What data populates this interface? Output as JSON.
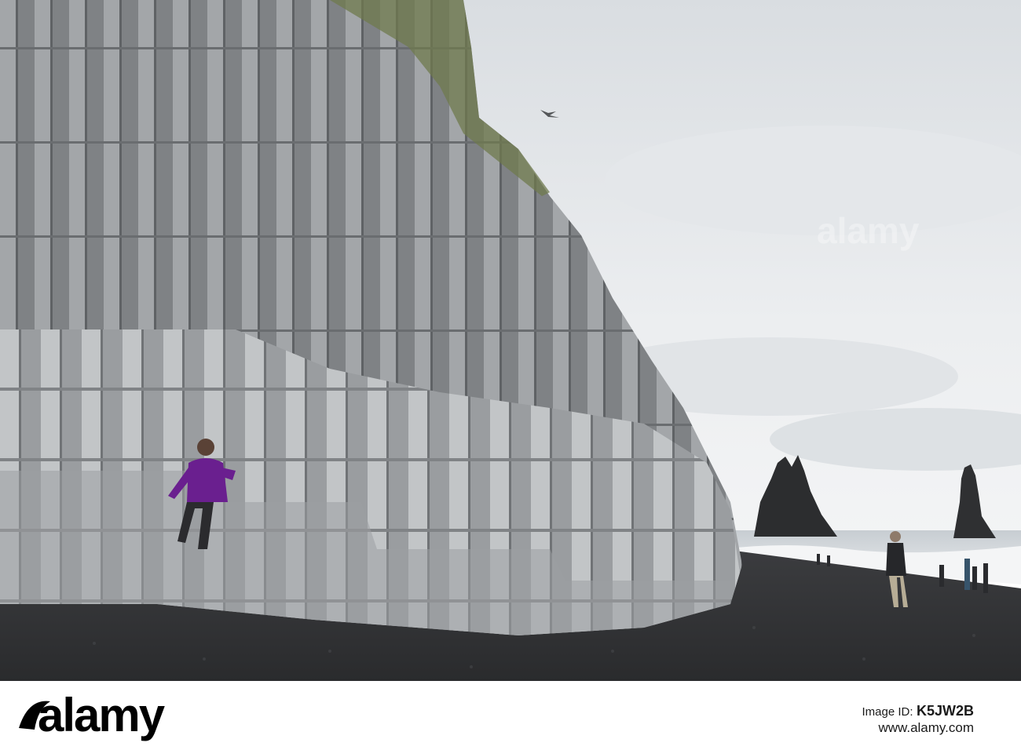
{
  "watermark": {
    "brand": "alamy",
    "image_id_label": "Image ID:",
    "image_id": "K5JW2B",
    "site": "www.alamy.com"
  },
  "scene": {
    "subject": "basalt-column-cliff-with-black-sand-beach-and-sea-stacks"
  }
}
